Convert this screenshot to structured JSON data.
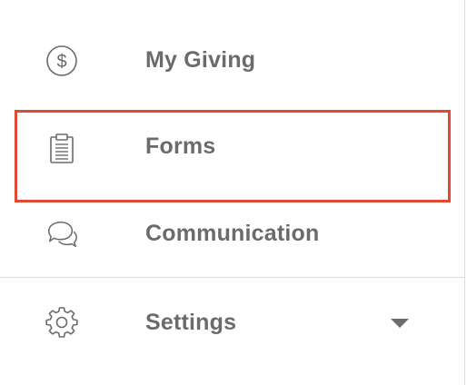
{
  "menu": {
    "items": [
      {
        "label": "My Giving",
        "icon": "dollar-circle-icon"
      },
      {
        "label": "Forms",
        "icon": "clipboard-icon"
      },
      {
        "label": "Communication",
        "icon": "chat-bubbles-icon"
      },
      {
        "label": "Settings",
        "icon": "gear-icon",
        "expandable": true,
        "expander_icon": "caret-down-icon"
      }
    ]
  },
  "colors": {
    "label_text": "#6b6b6b",
    "icon_stroke": "#6b6b6b",
    "divider": "#dcdcdc",
    "highlight": "#e04a32"
  }
}
